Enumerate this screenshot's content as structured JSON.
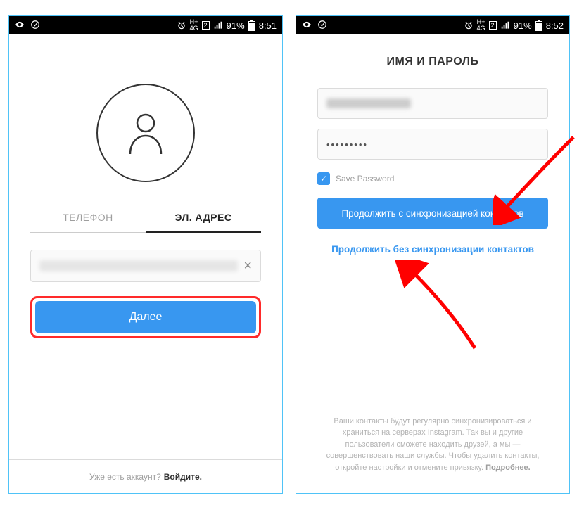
{
  "left": {
    "status": {
      "battery": "91%",
      "time": "8:51"
    },
    "tab_phone": "ТЕЛЕФОН",
    "tab_email": "ЭЛ. АДРЕС",
    "input_clear": "×",
    "next_button": "Далее",
    "footer_prompt": "Уже есть аккаунт?",
    "footer_login": "Войдите."
  },
  "right": {
    "status": {
      "battery": "91%",
      "time": "8:52"
    },
    "title": "ИМЯ И ПАРОЛЬ",
    "password_mask": "•••••••••",
    "save_password": "Save Password",
    "continue_sync": "Продолжить с синхронизацией контактов",
    "continue_nosync": "Продолжить без синхронизации контактов",
    "footer_text": "Ваши контакты будут регулярно синхронизироваться и храниться на серверах Instagram. Так вы и другие пользователи сможете находить друзей, а мы — совершенствовать наши службы. Чтобы удалить контакты, откройте настройки и отмените привязку.",
    "footer_more": "Подробнее."
  }
}
